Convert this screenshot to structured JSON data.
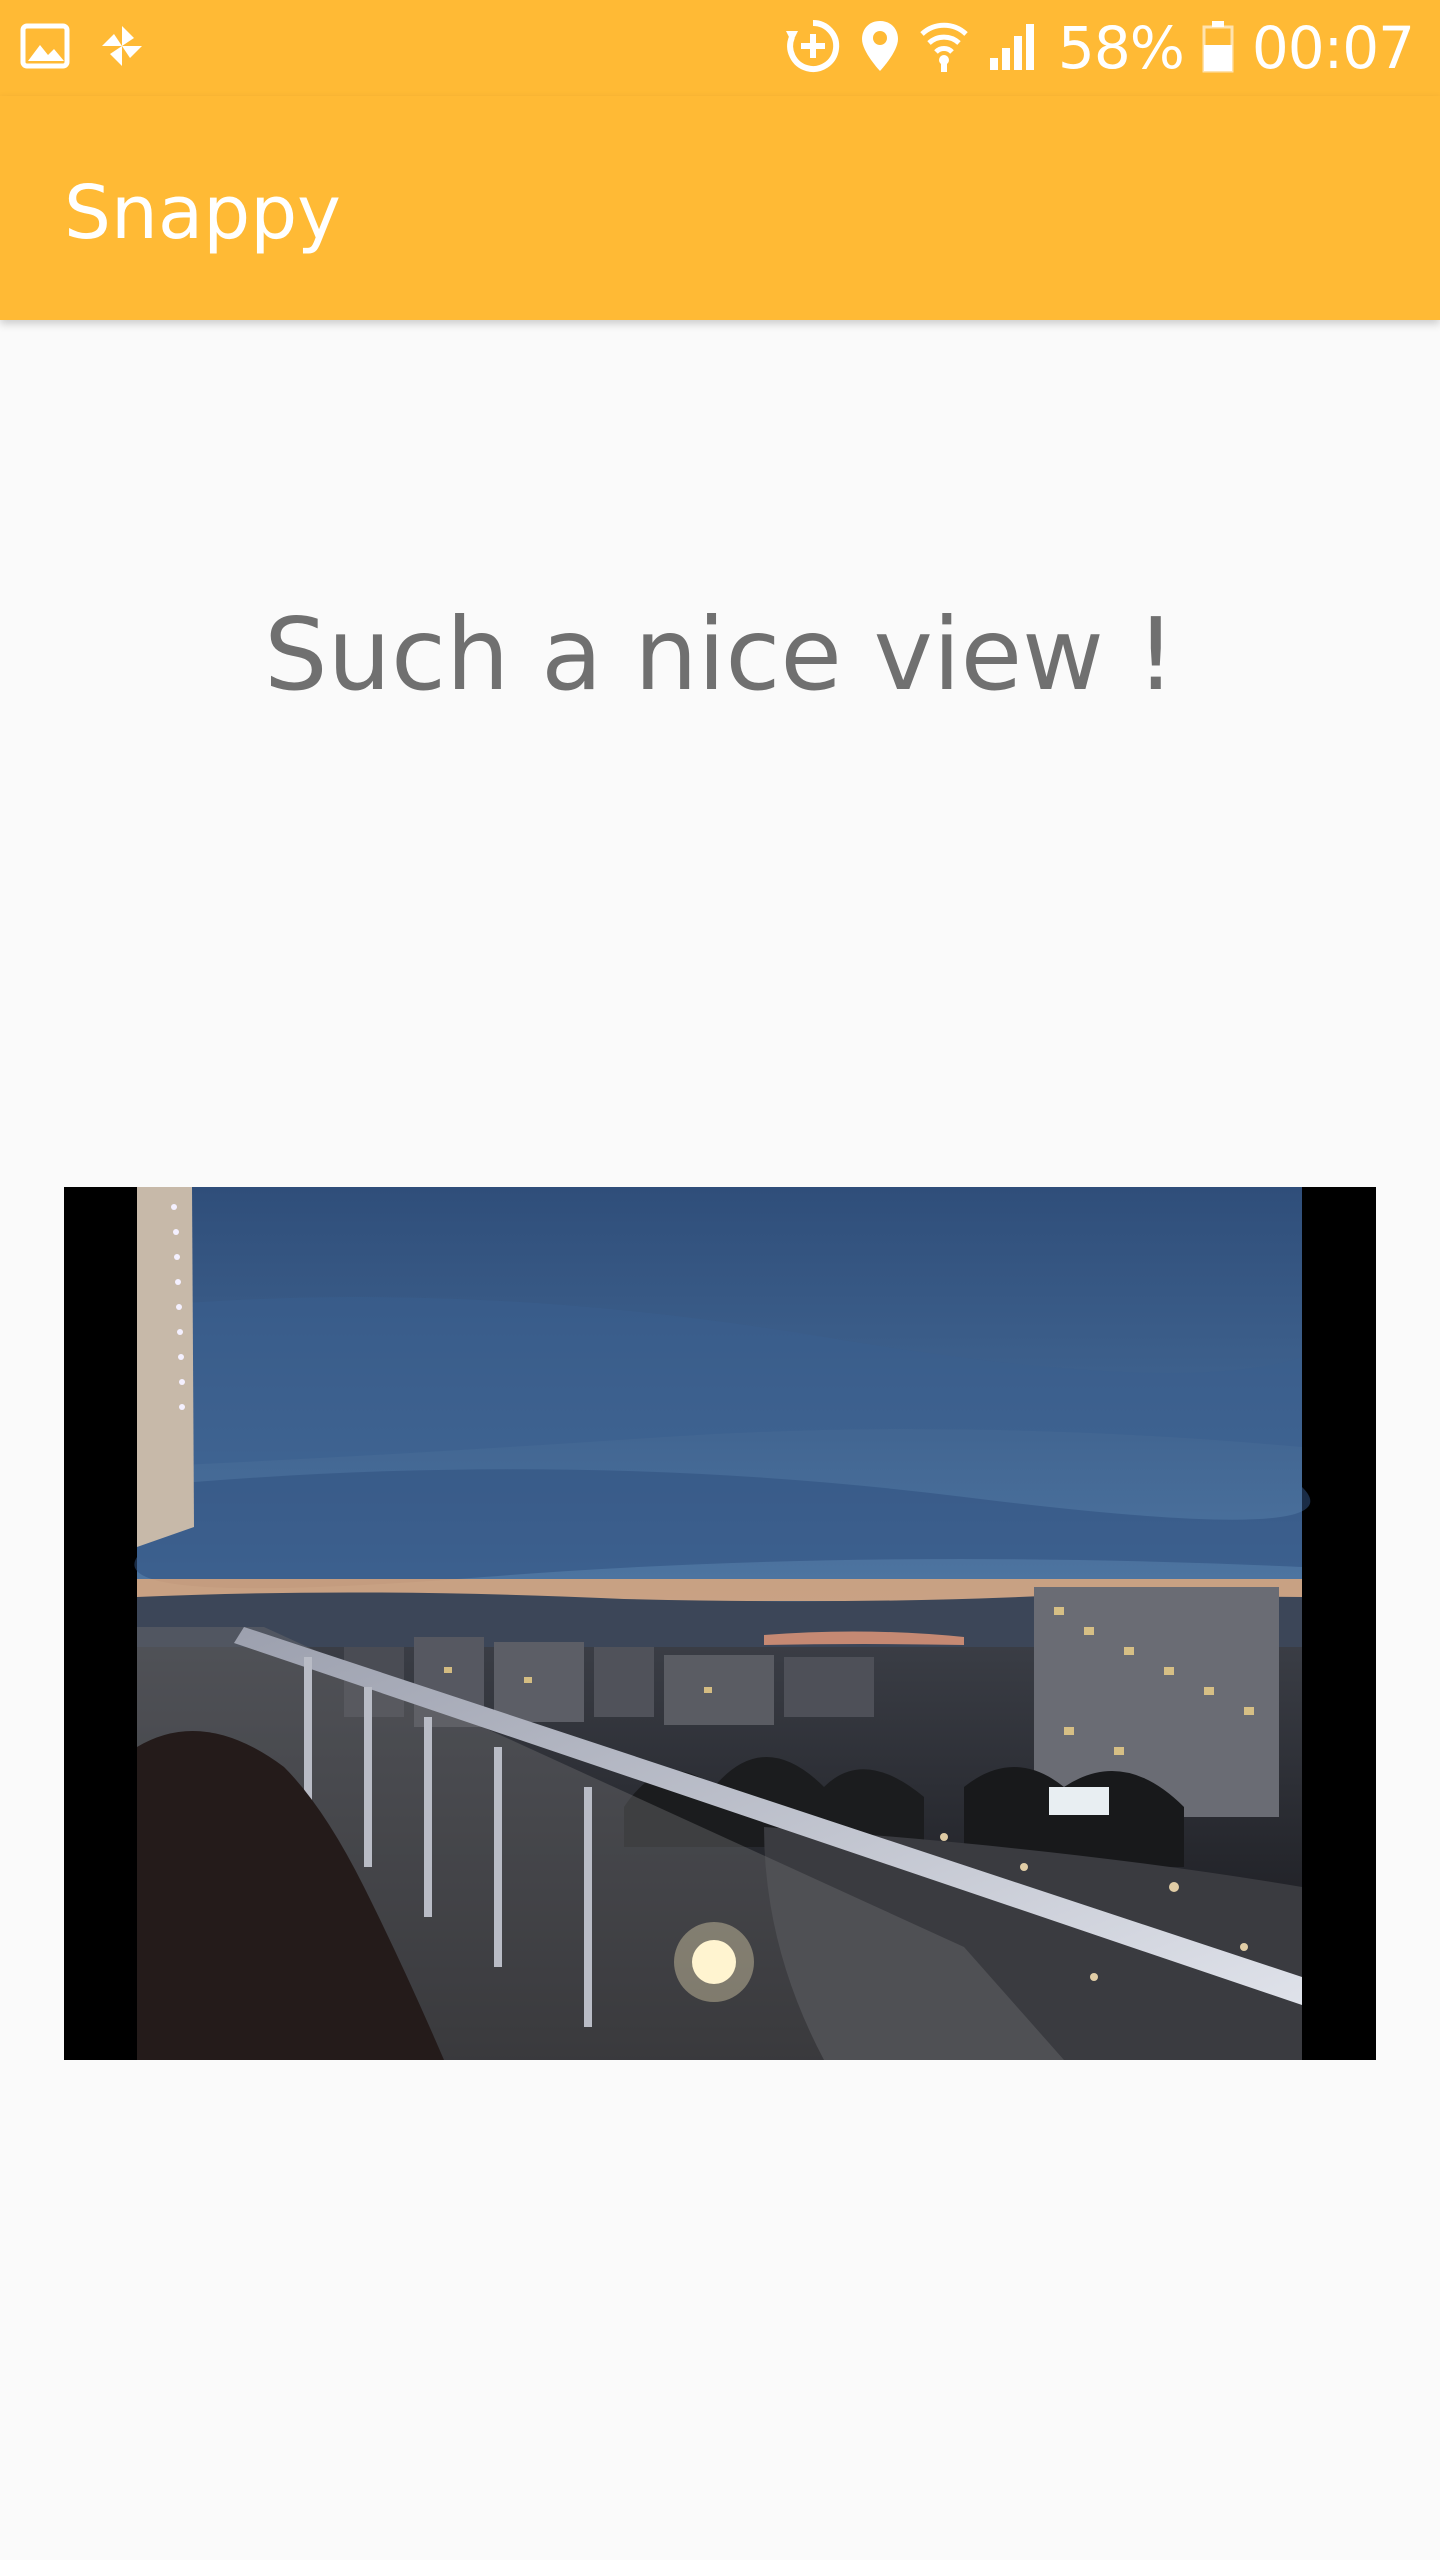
{
  "status_bar": {
    "battery_percent": "58%",
    "time": "00:07",
    "icons_left": [
      "gallery-icon",
      "pinwheel-icon"
    ],
    "icons_right": [
      "sync-plus-icon",
      "location-icon",
      "wifi-icon",
      "signal-icon",
      "battery-icon"
    ]
  },
  "app_bar": {
    "title": "Snappy",
    "color": "#FFBA35"
  },
  "main": {
    "heading": "Such a nice view !",
    "image": {
      "kind": "photograph",
      "subject": "balcony-city-dusk"
    }
  }
}
